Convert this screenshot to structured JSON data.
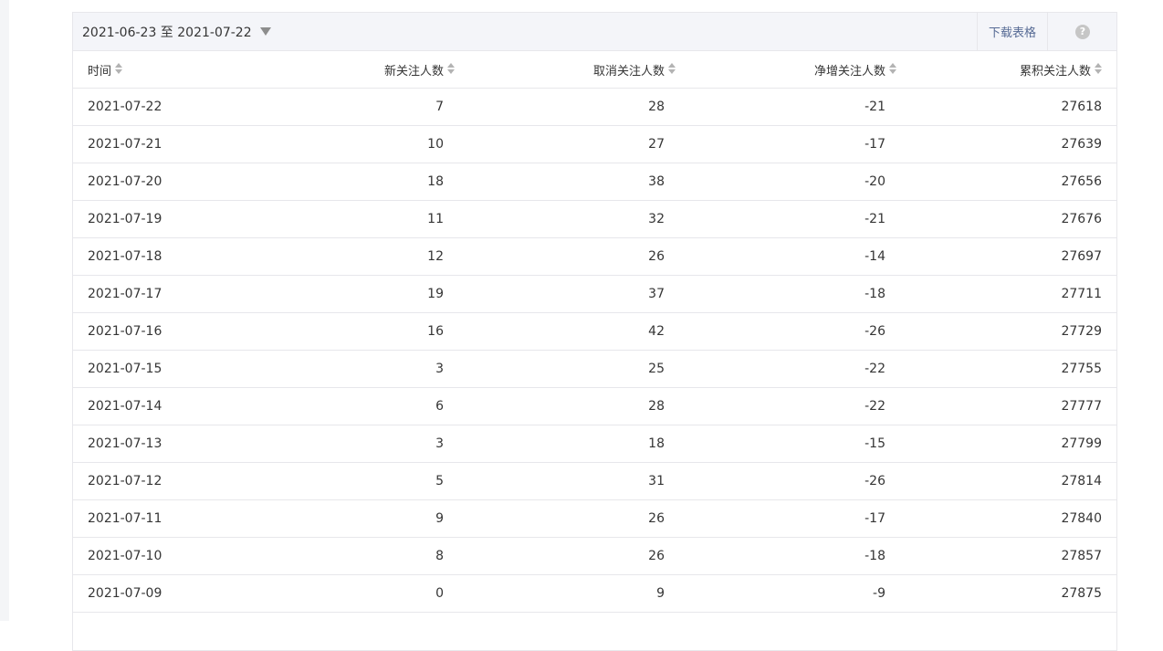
{
  "toolbar": {
    "date_range": "2021-06-23 至 2021-07-22",
    "download_label": "下载表格",
    "help_label": "?"
  },
  "table": {
    "columns": [
      "时间",
      "新关注人数",
      "取消关注人数",
      "净增关注人数",
      "累积关注人数"
    ],
    "rows": [
      [
        "2021-07-22",
        "7",
        "28",
        "-21",
        "27618"
      ],
      [
        "2021-07-21",
        "10",
        "27",
        "-17",
        "27639"
      ],
      [
        "2021-07-20",
        "18",
        "38",
        "-20",
        "27656"
      ],
      [
        "2021-07-19",
        "11",
        "32",
        "-21",
        "27676"
      ],
      [
        "2021-07-18",
        "12",
        "26",
        "-14",
        "27697"
      ],
      [
        "2021-07-17",
        "19",
        "37",
        "-18",
        "27711"
      ],
      [
        "2021-07-16",
        "16",
        "42",
        "-26",
        "27729"
      ],
      [
        "2021-07-15",
        "3",
        "25",
        "-22",
        "27755"
      ],
      [
        "2021-07-14",
        "6",
        "28",
        "-22",
        "27777"
      ],
      [
        "2021-07-13",
        "3",
        "18",
        "-15",
        "27799"
      ],
      [
        "2021-07-12",
        "5",
        "31",
        "-26",
        "27814"
      ],
      [
        "2021-07-11",
        "9",
        "26",
        "-17",
        "27840"
      ],
      [
        "2021-07-10",
        "8",
        "26",
        "-18",
        "27857"
      ],
      [
        "2021-07-09",
        "0",
        "9",
        "-9",
        "27875"
      ]
    ]
  },
  "colors": {
    "toolbar_bg": "#f4f5f9",
    "border": "#e7e7eb",
    "text": "#353535",
    "link": "#576b95"
  }
}
